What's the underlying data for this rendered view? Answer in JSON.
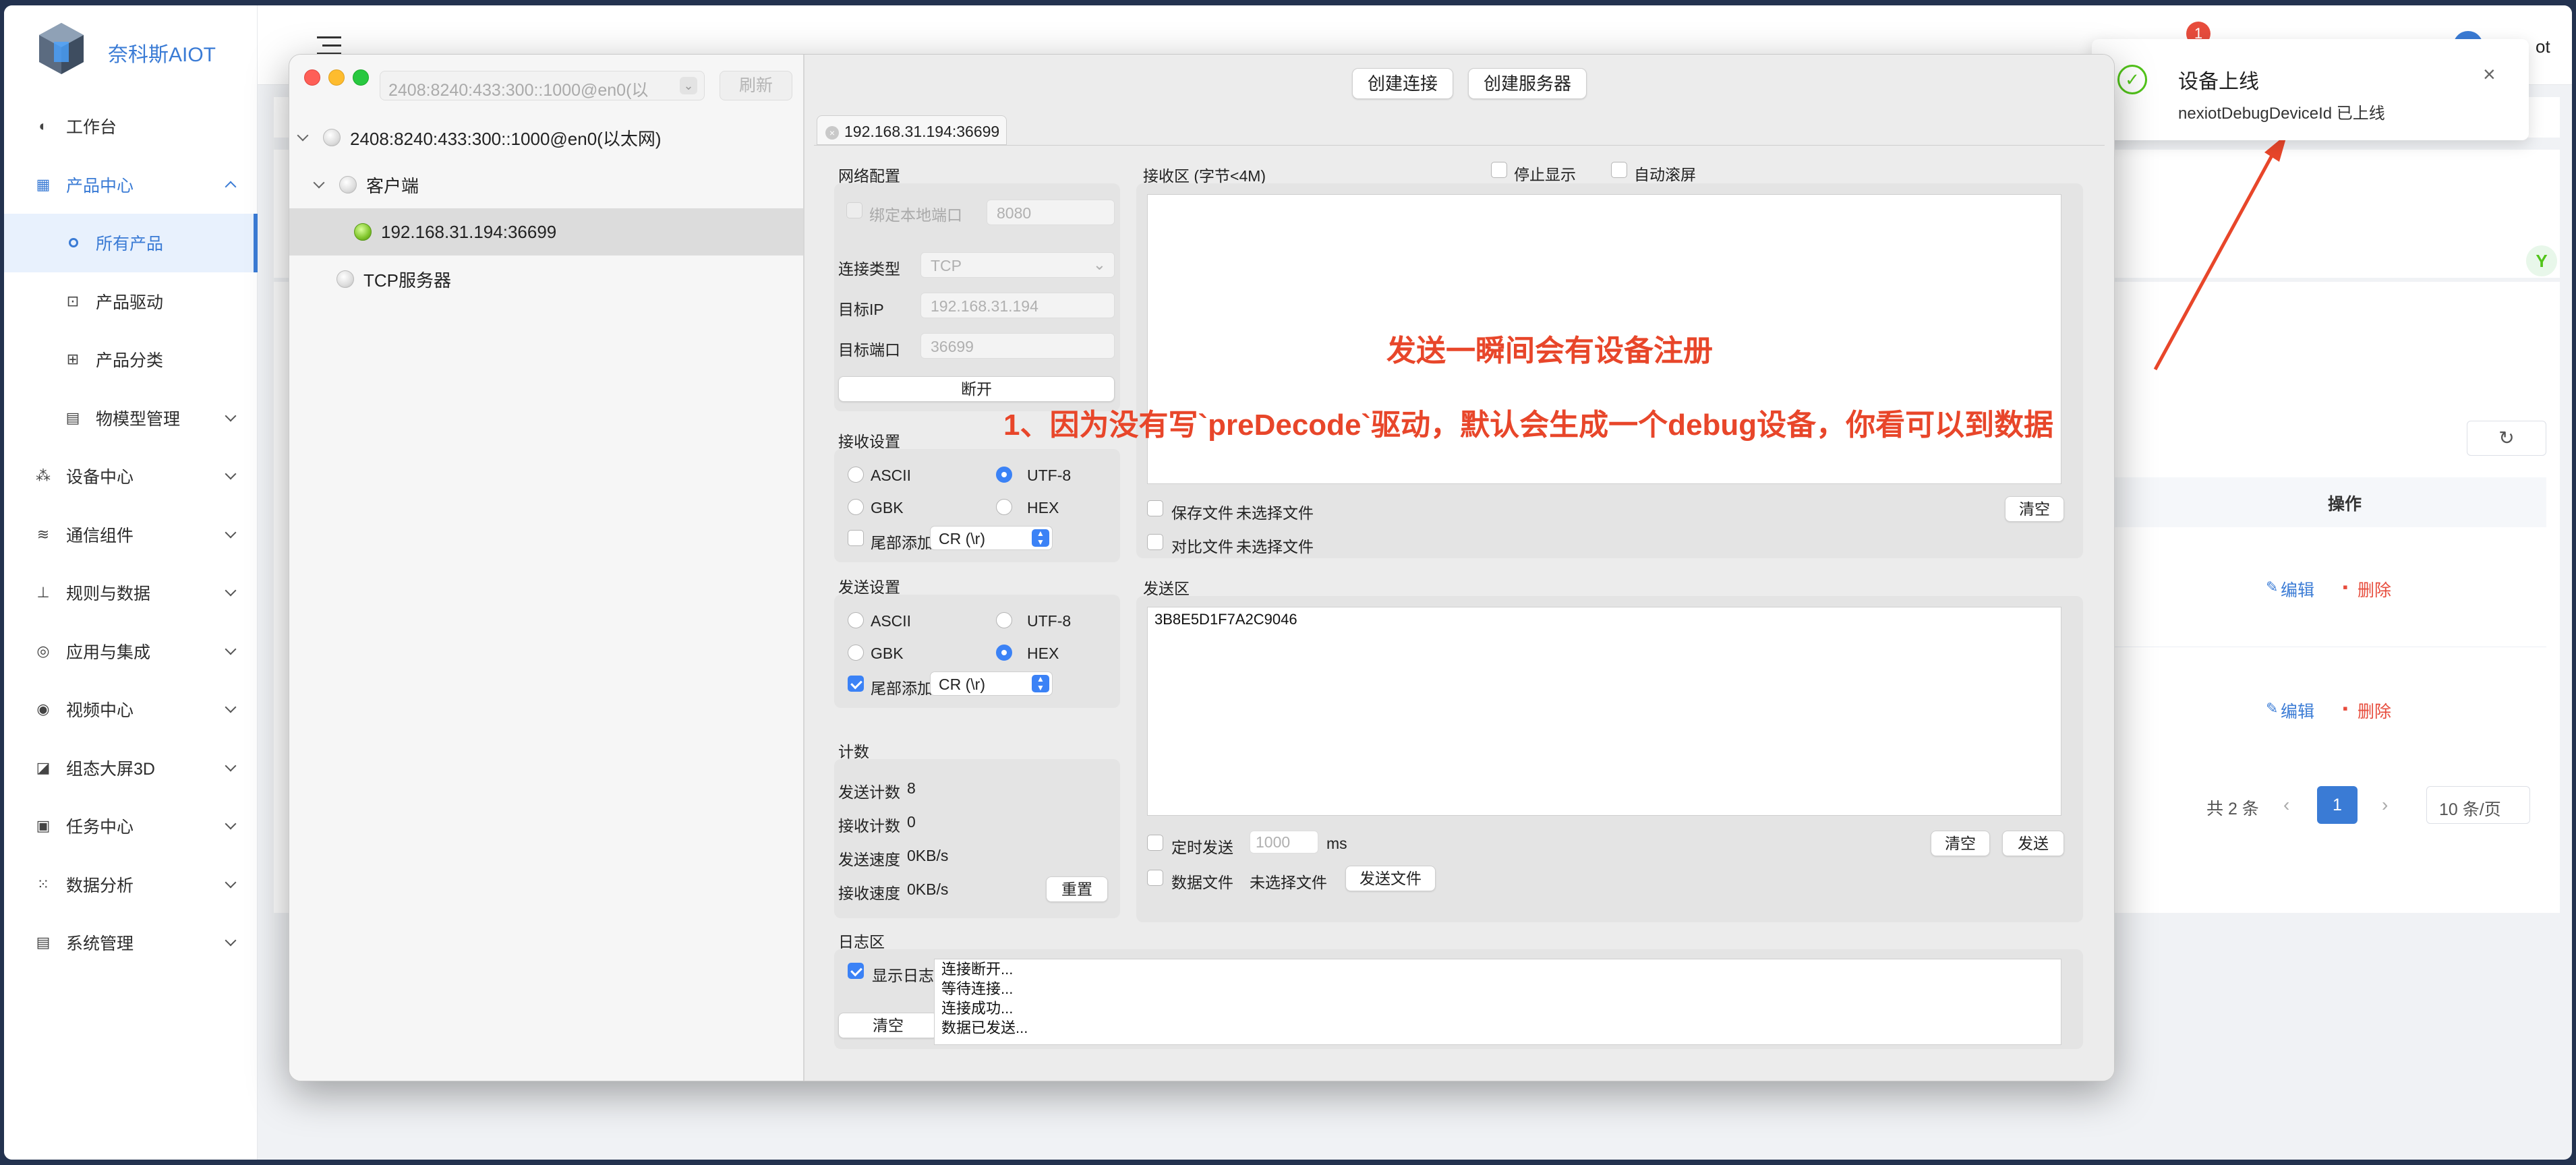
{
  "sidebar": {
    "brand": "奈科斯AIOT",
    "items": [
      {
        "label": "工作台",
        "icon": "dashboard-icon"
      },
      {
        "label": "产品中心",
        "icon": "product-center-icon"
      },
      {
        "label": "所有产品",
        "icon": "dot-icon"
      },
      {
        "label": "产品驱动",
        "icon": "driver-icon"
      },
      {
        "label": "产品分类",
        "icon": "category-icon"
      },
      {
        "label": "物模型管理",
        "icon": "model-icon"
      },
      {
        "label": "设备中心",
        "icon": "device-icon"
      },
      {
        "label": "通信组件",
        "icon": "wifi-icon"
      },
      {
        "label": "规则与数据",
        "icon": "rule-icon"
      },
      {
        "label": "应用与集成",
        "icon": "app-icon"
      },
      {
        "label": "视频中心",
        "icon": "eye-icon"
      },
      {
        "label": "组态大屏3D",
        "icon": "chart-icon"
      },
      {
        "label": "任务中心",
        "icon": "task-icon"
      },
      {
        "label": "数据分析",
        "icon": "analysis-icon"
      },
      {
        "label": "系统管理",
        "icon": "system-icon"
      }
    ]
  },
  "header": {
    "notif_count": "1",
    "user_suffix": "ot"
  },
  "background_page": {
    "col_action": "操作",
    "edit": "编辑",
    "delete": "删除",
    "total": "共 2 条",
    "page": "1",
    "page_size": "10 条/页"
  },
  "tool": {
    "address_combo": "2408:8240:433:300::1000@en0(以",
    "refresh": "刷新",
    "tree": {
      "root": "2408:8240:433:300::1000@en0(以太网)",
      "client": "客户端",
      "conn": "192.168.31.194:36699",
      "server": "TCP服务器"
    },
    "create_conn": "创建连接",
    "create_server": "创建服务器",
    "tab": "192.168.31.194:36699",
    "net": {
      "title": "网络配置",
      "bind_port_label": "绑定本地端口",
      "bind_port": "8080",
      "conn_type_label": "连接类型",
      "conn_type": "TCP",
      "target_ip_label": "目标IP",
      "target_ip": "192.168.31.194",
      "target_port_label": "目标端口",
      "target_port": "36699",
      "disconnect": "断开"
    },
    "recv_set": {
      "title": "接收设置",
      "ascii": "ASCII",
      "utf8": "UTF-8",
      "gbk": "GBK",
      "hex": "HEX",
      "tail": "尾部添加",
      "tail_val": "CR (\\r)"
    },
    "send_set": {
      "title": "发送设置",
      "ascii": "ASCII",
      "utf8": "UTF-8",
      "gbk": "GBK",
      "hex": "HEX",
      "tail": "尾部添加",
      "tail_val": "CR (\\r)"
    },
    "count": {
      "title": "计数",
      "send_label": "发送计数",
      "send": "8",
      "recv_label": "接收计数",
      "recv": "0",
      "send_speed_label": "发送速度",
      "send_speed": "0KB/s",
      "recv_speed_label": "接收速度",
      "recv_speed": "0KB/s",
      "reset": "重置"
    },
    "recv": {
      "title": "接收区 (字节<4M)",
      "stop_show": "停止显示",
      "auto_scroll": "自动滚屏",
      "save_file": "保存文件",
      "compare_file": "对比文件",
      "no_file": "未选择文件",
      "clear": "清空"
    },
    "send": {
      "title": "发送区",
      "content": "3B8E5D1F7A2C9046",
      "timer": "定时发送",
      "timer_ph": "1000",
      "ms": "ms",
      "data_file": "数据文件",
      "no_file": "未选择文件",
      "send_file": "发送文件",
      "clear": "清空",
      "send": "发送"
    },
    "log": {
      "title": "日志区",
      "show": "显示日志",
      "clear": "清空",
      "lines": "连接断开...\n等待连接...\n连接成功...\n数据已发送..."
    }
  },
  "annotations": {
    "a1": "发送一瞬间会有设备注册",
    "a2": "1、因为没有写`preDecode`驱动，默认会生成一个debug设备，你看可以到数据"
  },
  "toast": {
    "title": "设备上线",
    "message": "nexiotDebugDeviceId 已上线"
  },
  "colors": {
    "accent": "#3a7bd5",
    "annotation": "#e8462a",
    "success": "#52c41a"
  }
}
